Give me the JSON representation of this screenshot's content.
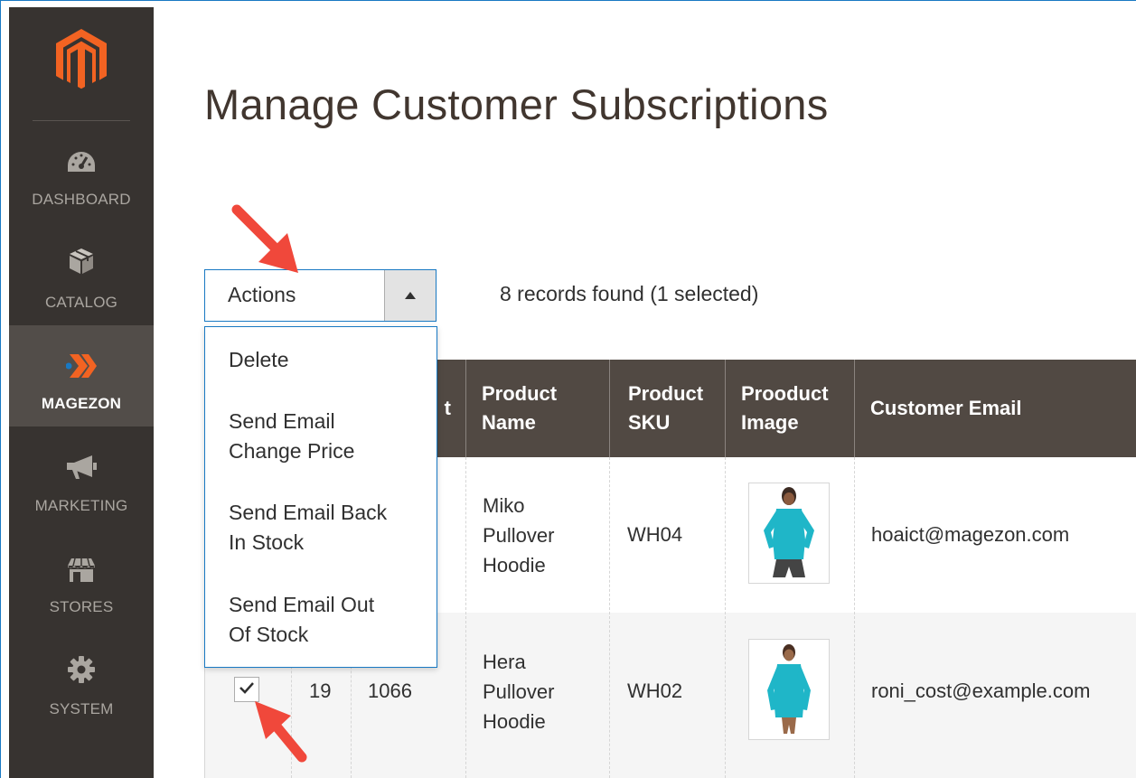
{
  "sidebar": {
    "items": [
      {
        "label": "DASHBOARD",
        "icon": "speedometer-icon"
      },
      {
        "label": "CATALOG",
        "icon": "box-icon"
      },
      {
        "label": "MAGEZON",
        "icon": "magezon-logo-icon"
      },
      {
        "label": "MARKETING",
        "icon": "megaphone-icon"
      },
      {
        "label": "STORES",
        "icon": "storefront-icon"
      },
      {
        "label": "SYSTEM",
        "icon": "gear-icon"
      }
    ],
    "active": "MAGEZON"
  },
  "page": {
    "title": "Manage Customer Subscriptions"
  },
  "toolbar": {
    "actions_label": "Actions",
    "records": "8 records found (1 selected)"
  },
  "dropdown": {
    "options": [
      "Delete",
      "Send Email Change Price",
      "Send Email Back In Stock",
      "Send Email Out Of Stock"
    ],
    "option_lines": [
      [
        "Delete"
      ],
      [
        "Send Email",
        "Change Price"
      ],
      [
        "Send Email Back",
        "In Stock"
      ],
      [
        "Send Email Out",
        "Of Stock"
      ]
    ]
  },
  "table": {
    "columns": [
      "Product Name",
      "Product SKU",
      "Prooduct Image",
      "Customer Email"
    ],
    "column_lines": [
      [
        "t"
      ],
      [
        "Product",
        "Name"
      ],
      [
        "Product",
        "SKU"
      ],
      [
        "Prooduct",
        "Image"
      ],
      [
        "Customer Email"
      ]
    ],
    "rows": [
      {
        "checked": false,
        "id": "",
        "product_id": "",
        "name_lines": [
          "Miko",
          "Pullover",
          "Hoodie"
        ],
        "sku": "WH04",
        "email": "hoaict@magezon.com"
      },
      {
        "checked": true,
        "id": "19",
        "product_id": "1066",
        "name_lines": [
          "Hera",
          "Pullover",
          "Hoodie"
        ],
        "sku": "WH02",
        "email": "roni_cost@example.com"
      }
    ]
  },
  "colors": {
    "sidebar_bg": "#373330",
    "sidebar_active_bg": "#524d49",
    "header_bg": "#514943",
    "accent": "#1979c3",
    "arrow": "#f0483b",
    "magento_orange": "#f26322"
  }
}
